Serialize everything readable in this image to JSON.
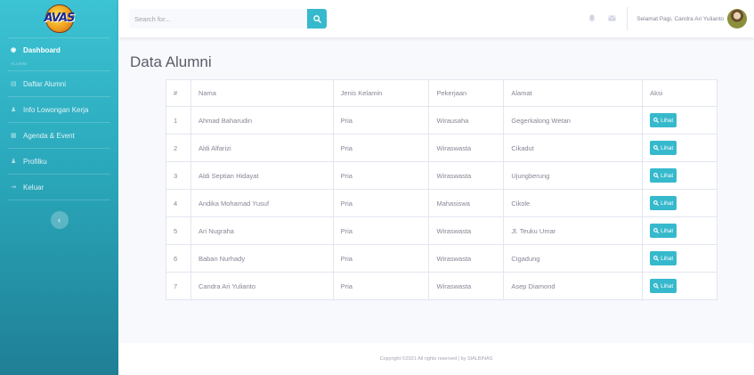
{
  "sidebar": {
    "logo_text": "AVAS",
    "dashboard_label": "Dashboard",
    "section_heading": "ALUMNI",
    "items": [
      {
        "label": "Daftar Alumni",
        "icon": "list-icon"
      },
      {
        "label": "Info Lowongan Kerja",
        "icon": "user-icon"
      },
      {
        "label": "Agenda & Event",
        "icon": "calendar-icon"
      },
      {
        "label": "Profilku",
        "icon": "user-icon"
      },
      {
        "label": "Keluar",
        "icon": "logout-icon"
      }
    ],
    "toggle_label": "‹"
  },
  "topbar": {
    "search_placeholder": "Search for...",
    "user_name": "Selamat Pagi, Candra Ari Yulianto"
  },
  "page": {
    "title": "Data Alumni"
  },
  "table": {
    "headers": [
      "#",
      "Nama",
      "Jenis Kelamin",
      "Pekerjaan",
      "Alamat",
      "Aksi"
    ],
    "button_label": "Lihat",
    "rows": [
      {
        "no": "1",
        "nama": "Ahmad Baharudin",
        "jk": "Pria",
        "pekerjaan": "Wirausaha",
        "alamat": "Gegerkalong Wetan"
      },
      {
        "no": "2",
        "nama": "Aldi Alfarizi",
        "jk": "Pria",
        "pekerjaan": "Wiraswasta",
        "alamat": "Cikadut"
      },
      {
        "no": "3",
        "nama": "Aldi Septian Hidayat",
        "jk": "Pria",
        "pekerjaan": "Wiraswasta",
        "alamat": "Ujungberung"
      },
      {
        "no": "4",
        "nama": "Andika Mohamad Yusuf",
        "jk": "Pria",
        "pekerjaan": "Mahasiswa",
        "alamat": "Cikole"
      },
      {
        "no": "5",
        "nama": "Ari Nugraha",
        "jk": "Pria",
        "pekerjaan": "Wiraswasta",
        "alamat": "Jl. Teuku Umar"
      },
      {
        "no": "6",
        "nama": "Baban Nurhady",
        "jk": "Pria",
        "pekerjaan": "Wiraswasta",
        "alamat": "Cigadung"
      },
      {
        "no": "7",
        "nama": "Candra Ari Yulianto",
        "jk": "Pria",
        "pekerjaan": "Wiraswasta",
        "alamat": "Asep Diamond"
      }
    ]
  },
  "footer": {
    "text": "Copyright ©2021 All rights reserved | by SIALBINAS"
  },
  "colors": {
    "accent": "#36b9cc",
    "sidebar_top": "#3cc3d4",
    "sidebar_bottom": "#1f7f95"
  }
}
